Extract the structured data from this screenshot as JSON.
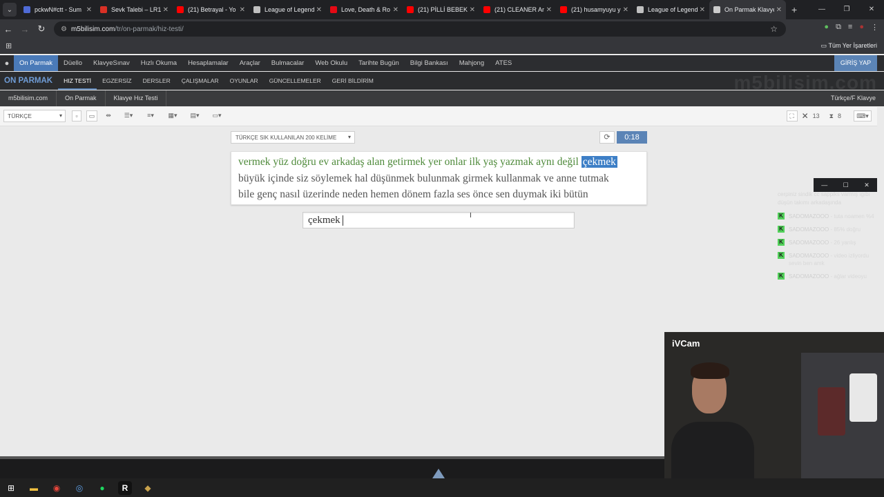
{
  "browser": {
    "tabs": [
      {
        "label": "pckwN#ctt - Sum",
        "fav_color": "#4f6bd6"
      },
      {
        "label": "Sevk Talebi – LR1",
        "fav_color": "#d93025"
      },
      {
        "label": "(21) Betrayal - Yo",
        "fav_color": "#ff0000"
      },
      {
        "label": "League of Legend",
        "fav_color": "#c0c0c0"
      },
      {
        "label": "Love, Death & Ro",
        "fav_color": "#e50914"
      },
      {
        "label": "(21) PİLLİ BEBEK E",
        "fav_color": "#ff0000"
      },
      {
        "label": "(21) CLEANER Ana",
        "fav_color": "#ff0000"
      },
      {
        "label": "(21) husamyuyu y",
        "fav_color": "#ff0000"
      },
      {
        "label": "League of Legend",
        "fav_color": "#c0c0c0"
      },
      {
        "label": "On Parmak Klavye",
        "fav_color": "#cccccc",
        "active": true
      }
    ],
    "url_host": "m5bilisim.com",
    "url_path": "/tr/on-parmak/hiz-testi/",
    "bookmarks_label": "Tüm Yer İşaretleri"
  },
  "site": {
    "top_nav": [
      "On Parmak",
      "Düello",
      "KlavyeSınav",
      "Hızlı Okuma",
      "Hesaplamalar",
      "Araçlar",
      "Bulmacalar",
      "Web Okulu",
      "Tarihte Bugün",
      "Bilgi Bankası",
      "Mahjong",
      "ATES"
    ],
    "login_label": "GİRİŞ YAP",
    "brand": "ON PARMAK",
    "sub_nav": [
      "HIZ TESTİ",
      "EGZERSİZ",
      "DERSLER",
      "ÇALIŞMALAR",
      "OYUNLAR",
      "GÜNCELLEMELER",
      "GERİ BİLDİRİM"
    ],
    "watermark": "m5bilisim.com",
    "breadcrumb": [
      "m5bilisim.com",
      "On Parmak",
      "Klavye Hız Testi"
    ],
    "keyboard_label": "Türkçe/F Klavye"
  },
  "toolbar": {
    "language": "TÜRKÇE",
    "errors_count": "13",
    "timer_count": "8"
  },
  "test": {
    "mode": "TÜRKÇE SIK KULLANILAN 200 KELİME",
    "timer": "0:18",
    "done_words": "vermek yüz doğru ev arkadaş alan getirmek yer onlar ilk yaş yazmak aynı değil",
    "current_word": "çekmek",
    "line2": "büyük içinde siz söylemek hal düşünmek bulunmak girmek kullanmak ve anne tutmak",
    "line3": "bile genç nasıl üzerinde neden hemen dönem fazla ses önce sen duymak iki bütün",
    "typed": "çekmek"
  },
  "chat": {
    "top_text": "cerpiniz sindik cc sappiks varmış ıgıbı düşün takımı arkadaşında",
    "messages": [
      {
        "user": "SADOMAZOOO",
        "text": "- tuta noamen %4"
      },
      {
        "user": "SADOMAZOOO",
        "text": "- 85% doğru"
      },
      {
        "user": "SADOMAZOOO",
        "text": "- 26 yanlış"
      },
      {
        "user": "SADOMAZOOO",
        "text": "- video izliyordu sevin ben amk"
      },
      {
        "user": "SADOMAZOOO",
        "text": "- ağlar videoyu"
      }
    ]
  },
  "webcam": {
    "label": "iVCam"
  }
}
